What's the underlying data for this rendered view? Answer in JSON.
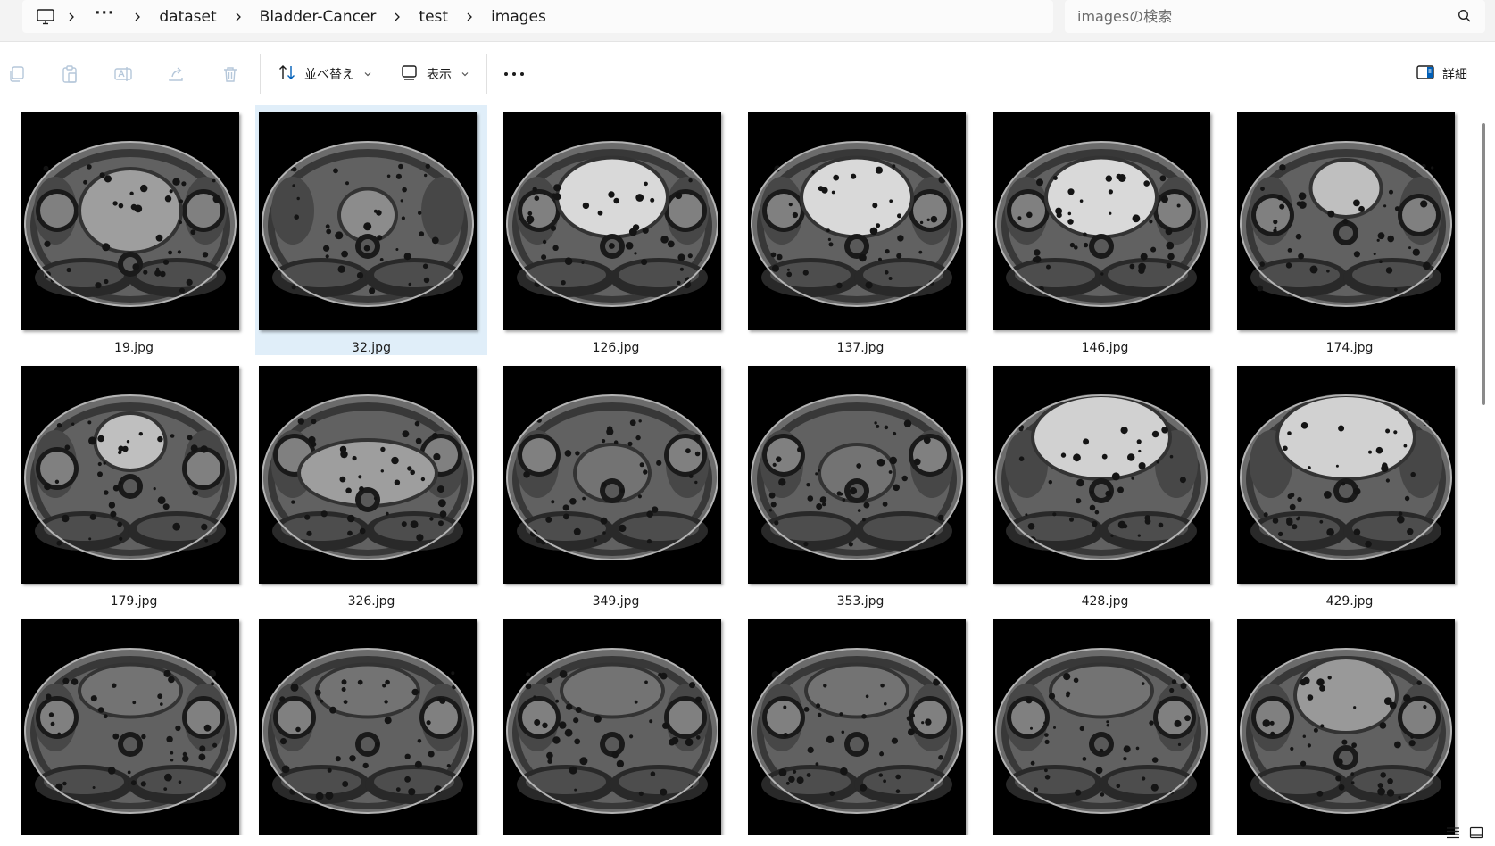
{
  "breadcrumb": {
    "overflow": "···",
    "items": [
      {
        "label": "dataset"
      },
      {
        "label": "Bladder-Cancer"
      },
      {
        "label": "test"
      },
      {
        "label": "images"
      }
    ]
  },
  "search": {
    "placeholder": "imagesの検索"
  },
  "toolbar": {
    "sort_label": "並べ替え",
    "view_label": "表示",
    "details_label": "詳細"
  },
  "files": [
    {
      "name": "19.jpg",
      "selected": false,
      "variant": "a"
    },
    {
      "name": "32.jpg",
      "selected": true,
      "variant": "b"
    },
    {
      "name": "126.jpg",
      "selected": false,
      "variant": "c"
    },
    {
      "name": "137.jpg",
      "selected": false,
      "variant": "c"
    },
    {
      "name": "146.jpg",
      "selected": false,
      "variant": "c"
    },
    {
      "name": "174.jpg",
      "selected": false,
      "variant": "d"
    },
    {
      "name": "179.jpg",
      "selected": false,
      "variant": "d"
    },
    {
      "name": "326.jpg",
      "selected": false,
      "variant": "e"
    },
    {
      "name": "349.jpg",
      "selected": false,
      "variant": "f"
    },
    {
      "name": "353.jpg",
      "selected": false,
      "variant": "f"
    },
    {
      "name": "428.jpg",
      "selected": false,
      "variant": "g"
    },
    {
      "name": "429.jpg",
      "selected": false,
      "variant": "g"
    },
    {
      "name": "",
      "selected": false,
      "variant": "h"
    },
    {
      "name": "",
      "selected": false,
      "variant": "h"
    },
    {
      "name": "",
      "selected": false,
      "variant": "h"
    },
    {
      "name": "",
      "selected": false,
      "variant": "h"
    },
    {
      "name": "",
      "selected": false,
      "variant": "h"
    },
    {
      "name": "",
      "selected": false,
      "variant": "i"
    }
  ],
  "colors": {
    "selection": "#e0eef9",
    "accent": "#005fb8"
  }
}
